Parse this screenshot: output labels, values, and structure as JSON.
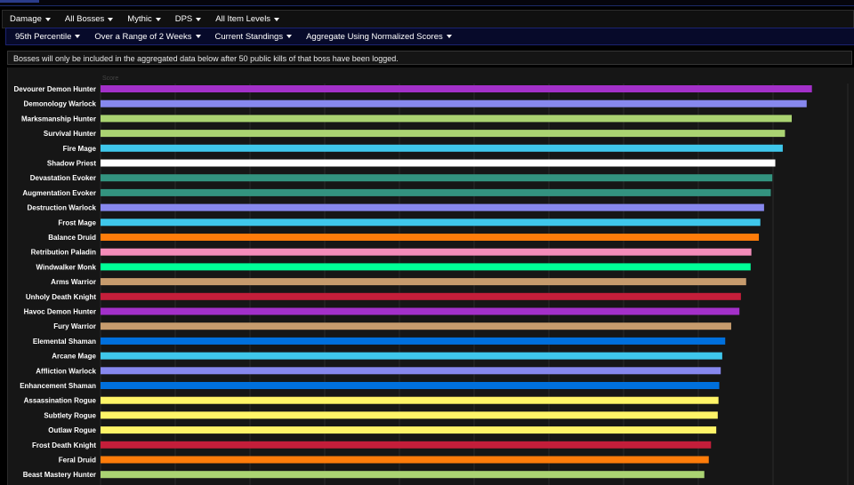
{
  "filters": {
    "row1": [
      {
        "label": "Damage"
      },
      {
        "label": "All Bosses"
      },
      {
        "label": "Mythic"
      },
      {
        "label": "DPS"
      },
      {
        "label": "All Item Levels"
      }
    ],
    "row2": [
      {
        "label": "95th Percentile"
      },
      {
        "label": "Over a Range of 2 Weeks"
      },
      {
        "label": "Current Standings"
      },
      {
        "label": "Aggregate Using Normalized Scores"
      }
    ]
  },
  "notice": "Bosses will only be included in the aggregated data below after 50 public kills of that boss have been logged.",
  "chart_data": {
    "type": "bar",
    "orientation": "horizontal",
    "xlabel": "Score",
    "xlim": [
      0,
      100
    ],
    "grid": true,
    "categories": [
      "Devourer Demon Hunter",
      "Demonology Warlock",
      "Marksmanship Hunter",
      "Survival Hunter",
      "Fire Mage",
      "Shadow Priest",
      "Devastation Evoker",
      "Augmentation Evoker",
      "Destruction Warlock",
      "Frost Mage",
      "Balance Druid",
      "Retribution Paladin",
      "Windwalker Monk",
      "Arms Warrior",
      "Unholy Death Knight",
      "Havoc Demon Hunter",
      "Fury Warrior",
      "Elemental Shaman",
      "Arcane Mage",
      "Affliction Warlock",
      "Enhancement Shaman",
      "Assassination Rogue",
      "Subtlety Rogue",
      "Outlaw Rogue",
      "Frost Death Knight",
      "Feral Druid",
      "Beast Mastery Hunter"
    ],
    "values": [
      95.2,
      94.5,
      92.5,
      91.6,
      91.3,
      90.3,
      89.9,
      89.7,
      88.8,
      88.3,
      88.1,
      87.1,
      87.0,
      86.4,
      85.7,
      85.5,
      84.4,
      83.6,
      83.2,
      83.0,
      82.8,
      82.7,
      82.6,
      82.4,
      81.7,
      81.4,
      80.8
    ],
    "colors": [
      "#A330C9",
      "#8788EE",
      "#AAD372",
      "#AAD372",
      "#3FC7EB",
      "#FFFFFF",
      "#33937F",
      "#33937F",
      "#8788EE",
      "#3FC7EB",
      "#FF7C0A",
      "#F48CBA",
      "#00FF98",
      "#C69B6D",
      "#C41E3A",
      "#A330C9",
      "#C69B6D",
      "#0070DD",
      "#3FC7EB",
      "#8788EE",
      "#0070DD",
      "#FFF468",
      "#FFF468",
      "#FFF468",
      "#C41E3A",
      "#FF7C0A",
      "#AAD372"
    ]
  }
}
